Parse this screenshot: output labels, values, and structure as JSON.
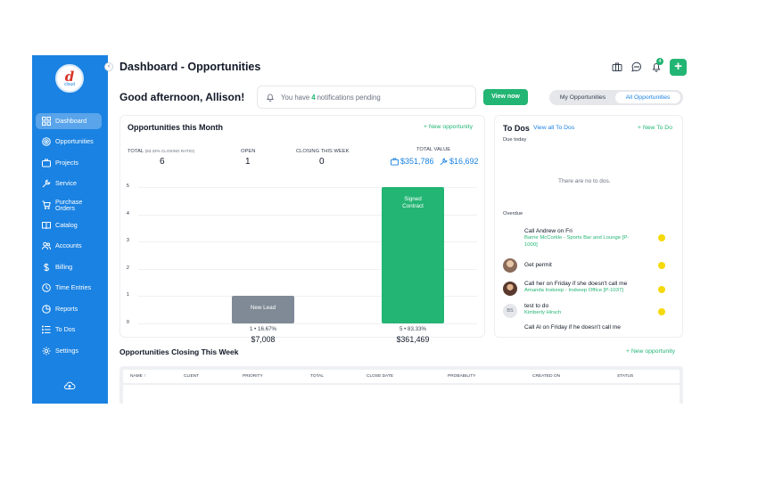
{
  "app": {
    "logo_text": "cloud",
    "logo_mark": "d"
  },
  "sidebar": {
    "items": [
      {
        "label": "Dashboard",
        "icon": "dashboard-icon",
        "active": true
      },
      {
        "label": "Opportunities",
        "icon": "target-icon"
      },
      {
        "label": "Projects",
        "icon": "briefcase-icon"
      },
      {
        "label": "Service",
        "icon": "wrench-icon"
      },
      {
        "label": "Purchase Orders",
        "icon": "cart-icon"
      },
      {
        "label": "Catalog",
        "icon": "book-icon"
      },
      {
        "label": "Accounts",
        "icon": "users-icon"
      },
      {
        "label": "Billing",
        "icon": "dollar-icon"
      },
      {
        "label": "Time Entries",
        "icon": "clock-icon"
      },
      {
        "label": "Reports",
        "icon": "report-icon"
      },
      {
        "label": "To Dos",
        "icon": "list-icon"
      },
      {
        "label": "Settings",
        "icon": "gear-icon"
      }
    ]
  },
  "header": {
    "title": "Dashboard - Opportunities",
    "notification_count": "4"
  },
  "greeting": "Good afternoon, Allison!",
  "notifications": {
    "prefix": "You have",
    "count": "4",
    "suffix": "notifications pending",
    "view_now": "View now"
  },
  "toggle": {
    "my": "My Opportunities",
    "all": "All Opportunities"
  },
  "opportunities": {
    "title": "Opportunities this Month",
    "new_link": "+ New opportunity",
    "stats": {
      "total_label": "TOTAL",
      "total_sub": "(83.33% CLOSING RATIO)",
      "total_value": "6",
      "open_label": "OPEN",
      "open_value": "1",
      "closing_label": "CLOSING THIS WEEK",
      "closing_value": "0",
      "total_value_label": "TOTAL VALUE",
      "value_projects": "$351,786",
      "value_service": "$16,692"
    }
  },
  "chart_data": {
    "type": "bar",
    "categories": [
      "New Lead",
      "Signed Contract"
    ],
    "values": [
      1,
      5
    ],
    "colors": [
      "#7f8a96",
      "#22b573"
    ],
    "ylim": [
      0,
      5
    ],
    "yticks": [
      "0",
      "1",
      "2",
      "3",
      "4",
      "5"
    ],
    "meta": [
      "1 • 16.67%",
      "5 • 83.33%"
    ],
    "totals": [
      "$7,008",
      "$361,469"
    ],
    "grid": true
  },
  "todos": {
    "title": "To Dos",
    "view_all": "View all To Dos",
    "new_link": "+ New To Do",
    "due_today": "Due today",
    "empty": "There are no to dos.",
    "overdue": "Overdue",
    "items": [
      {
        "title": "Call Andrew on Fri",
        "sub": "Barrie McCorkle - Sports Bar and Lounge [P-1000]",
        "avatar": ""
      },
      {
        "title": "Get permit",
        "sub": "",
        "avatar": "photo"
      },
      {
        "title": "Call her on Friday if she doesn't call me",
        "sub": "Amanda Inskeep - Inskeep Office [P-1037]",
        "avatar": "photo"
      },
      {
        "title": "test to do",
        "sub": "Kimberly Hirsch",
        "avatar": "BS"
      },
      {
        "title": "Call Al on Friday if he doesn't call me",
        "sub": "",
        "avatar": ""
      }
    ]
  },
  "closing": {
    "title": "Opportunities Closing This Week",
    "new_link": "+ New opportunity",
    "columns": [
      "NAME",
      "CLIENT",
      "PRIORITY",
      "TOTAL",
      "CLOSE DATE",
      "PROBABILITY",
      "CREATED ON",
      "STATUS"
    ]
  }
}
